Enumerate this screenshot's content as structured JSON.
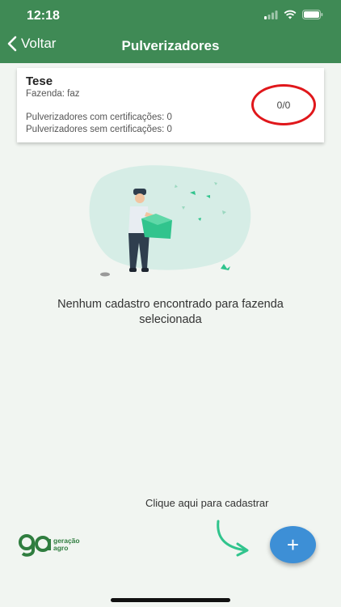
{
  "status_bar": {
    "time": "12:18"
  },
  "nav": {
    "back_label": "Voltar",
    "title": "Pulverizadores"
  },
  "farm_card": {
    "title": "Tese",
    "farm_label": "Fazenda: faz",
    "with_cert": "Pulverizadores com certificações: 0",
    "without_cert": "Pulverizadores sem certificações: 0",
    "count": "0/0"
  },
  "empty_state": {
    "message": "Nenhum cadastro encontrado para fazenda selecionada"
  },
  "add_hint": "Clique aqui para cadastrar",
  "fab": {
    "symbol": "+"
  },
  "logo": {
    "line1": "geração",
    "line2": "agro",
    "mark": "ga"
  },
  "colors": {
    "header": "#3f8a55",
    "fab": "#3d8fd6",
    "highlight": "#e0171b",
    "accent": "#31c48d"
  },
  "icons": [
    "signal-icon",
    "wifi-icon",
    "battery-icon",
    "back-chevron-icon",
    "arrow-icon",
    "plus-icon"
  ]
}
